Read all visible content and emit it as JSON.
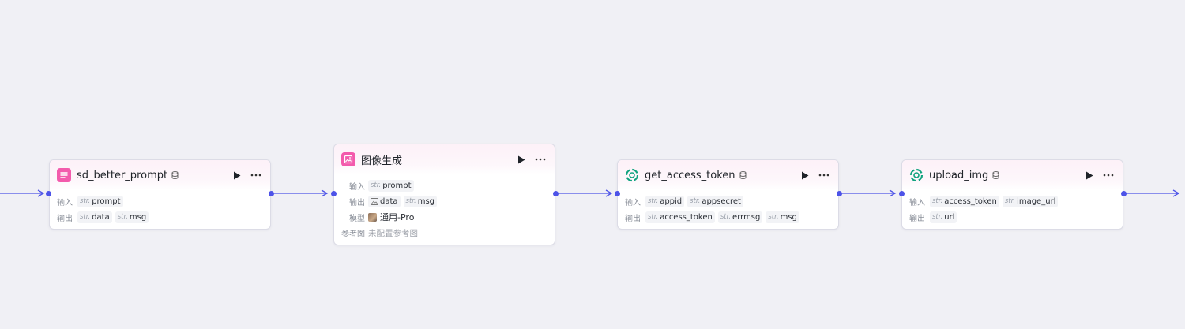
{
  "labels": {
    "input": "输入",
    "output": "输出",
    "model": "模型",
    "reference": "参考图"
  },
  "type_str": "str.",
  "nodes": [
    {
      "id": "sd_better_prompt",
      "title": "sd_better_prompt",
      "icon": "list-icon",
      "icon_color": "#f35aac",
      "inputs": [
        "prompt"
      ],
      "outputs": [
        "data",
        "msg"
      ]
    },
    {
      "id": "image_gen",
      "title": "图像生成",
      "icon": "image-gen-icon",
      "icon_color": "#f35aac",
      "inputs": [
        "prompt"
      ],
      "outputs": [
        {
          "type": "image",
          "name": "data"
        },
        {
          "type": "str",
          "name": "msg"
        }
      ],
      "model": "通用-Pro",
      "reference": "未配置参考图"
    },
    {
      "id": "get_access_token",
      "title": "get_access_token",
      "icon": "chatgpt-icon",
      "icon_color": "#10a37f",
      "inputs": [
        "appid",
        "appsecret"
      ],
      "outputs": [
        "access_token",
        "errmsg",
        "msg"
      ]
    },
    {
      "id": "upload_img",
      "title": "upload_img",
      "icon": "chatgpt-icon",
      "icon_color": "#10a37f",
      "inputs": [
        "access_token",
        "image_url"
      ],
      "outputs": [
        "url"
      ]
    }
  ],
  "colors": {
    "edge": "#4d53e8",
    "canvas": "#f0f0f5",
    "pink": "#f35aac",
    "green": "#10a37f"
  }
}
